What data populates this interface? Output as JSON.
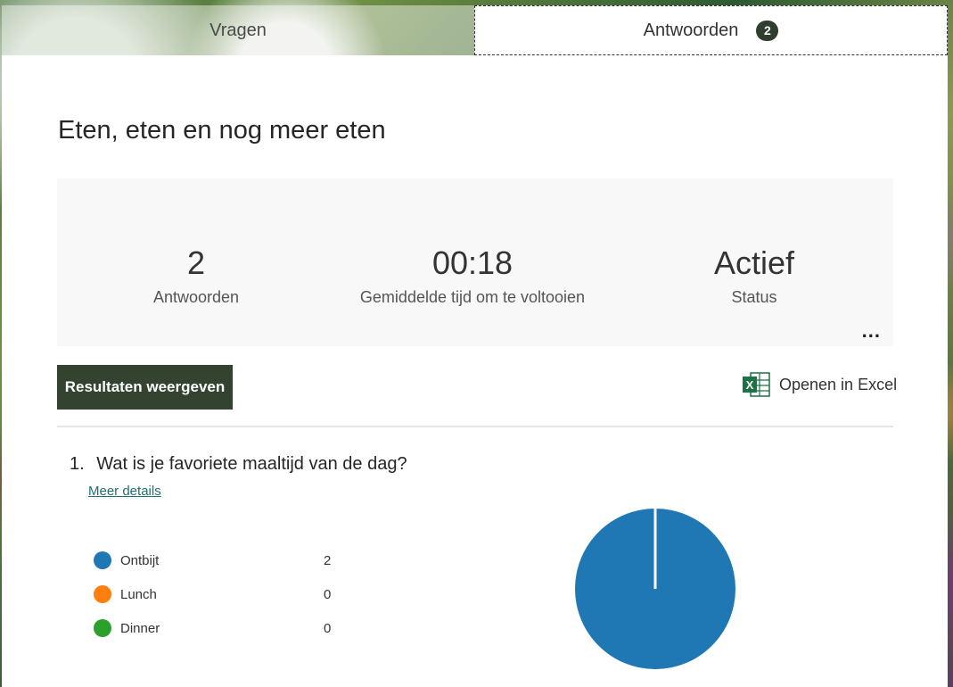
{
  "tabs": [
    {
      "label": "Vragen"
    },
    {
      "label": "Antwoorden",
      "badge": "2"
    }
  ],
  "form": {
    "title": "Eten, eten en nog meer eten"
  },
  "summary": {
    "responses": {
      "value": "2",
      "label": "Antwoorden"
    },
    "avg_time": {
      "value": "00:18",
      "label": "Gemiddelde tijd om te voltooien"
    },
    "status": {
      "value": "Actief",
      "label": "Status"
    },
    "more": "..."
  },
  "actions": {
    "results_button": "Resultaten weergeven",
    "open_excel": "Openen in Excel"
  },
  "question": {
    "number": "1.",
    "text": "Wat is je favoriete maaltijd van de dag?",
    "details_link": "Meer details",
    "options": [
      {
        "label": "Ontbijt",
        "count": "2",
        "color": "#1f77b4"
      },
      {
        "label": "Lunch",
        "count": "0",
        "color": "#ff7f0e"
      },
      {
        "label": "Dinner",
        "count": "0",
        "color": "#2ca02c"
      }
    ]
  },
  "chart_data": {
    "type": "pie",
    "categories": [
      "Ontbijt",
      "Lunch",
      "Dinner"
    ],
    "values": [
      2,
      0,
      0
    ],
    "colors": [
      "#1f77b4",
      "#ff7f0e",
      "#2ca02c"
    ]
  },
  "colors": {
    "accent": "#33432f",
    "link": "#1f6f73",
    "excel_green": "#1e7145"
  }
}
